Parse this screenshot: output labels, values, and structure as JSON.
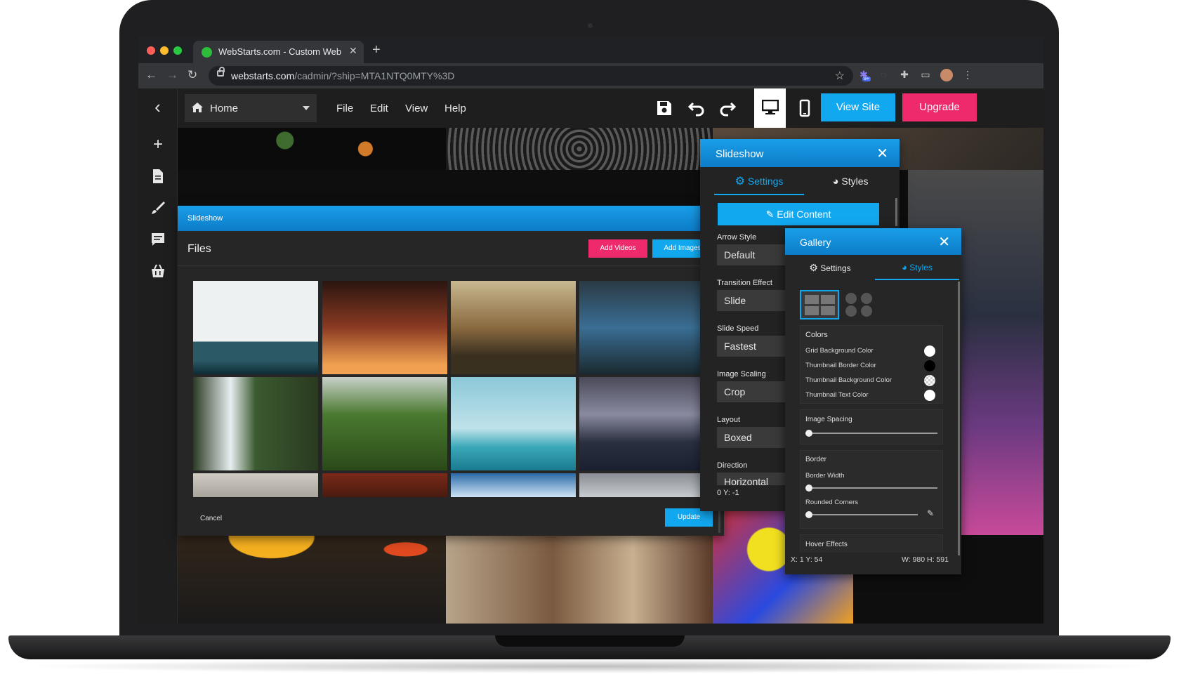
{
  "browser": {
    "tab_title": "WebStarts.com - Custom Web",
    "url_host": "webstarts.com",
    "url_path": "/cadmin/?ship=MTA1NTQ0MTY%3D",
    "extension_badge": "9+"
  },
  "appbar": {
    "page_select": "Home",
    "menus": [
      "File",
      "Edit",
      "View",
      "Help"
    ],
    "view_site_label": "View Site",
    "upgrade_label": "Upgrade"
  },
  "files_dialog": {
    "header_title": "Slideshow",
    "section_title": "Files",
    "add_videos_label": "Add Videos",
    "add_images_label": "Add Images",
    "cancel_label": "Cancel",
    "update_label": "Update"
  },
  "slideshow_panel": {
    "title": "Slideshow",
    "tab_settings": "Settings",
    "tab_styles": "Styles",
    "edit_content_label": "Edit Content",
    "fields": [
      {
        "label": "Arrow Style",
        "value": "Default"
      },
      {
        "label": "Transition Effect",
        "value": "Slide"
      },
      {
        "label": "Slide Speed",
        "value": "Fastest"
      },
      {
        "label": "Image Scaling",
        "value": "Crop"
      },
      {
        "label": "Layout",
        "value": "Boxed"
      },
      {
        "label": "Direction",
        "value": "Horizontal"
      }
    ],
    "coords": "0 Y: -1"
  },
  "gallery_panel": {
    "title": "Gallery",
    "tab_settings": "Settings",
    "tab_styles": "Styles",
    "colors_title": "Colors",
    "color_rows": [
      {
        "label": "Grid Background Color",
        "color": "#ffffff"
      },
      {
        "label": "Thumbnail Border Color",
        "color": "#000000"
      },
      {
        "label": "Thumbnail Background Color",
        "color": "#dddddd"
      },
      {
        "label": "Thumbnail Text Color",
        "color": "#ffffff"
      }
    ],
    "image_spacing_title": "Image Spacing",
    "border_title": "Border",
    "border_width_label": "Border Width",
    "rounded_corners_label": "Rounded Corners",
    "hover_effects_title": "Hover Effects",
    "coords_xy": "X: 1 Y: 54",
    "coords_wh": "W: 980 H: 591"
  },
  "colors": {
    "accent_blue": "#12a8f0",
    "accent_pink": "#ef2a6c"
  },
  "icons": [
    "back-arrow-icon",
    "home-icon",
    "save-icon",
    "undo-icon",
    "redo-icon",
    "desktop-icon",
    "mobile-icon",
    "plus-icon",
    "page-icon",
    "brush-icon",
    "comment-icon",
    "store-icon",
    "gear-icon",
    "palette-icon",
    "pencil-icon",
    "close-icon"
  ]
}
